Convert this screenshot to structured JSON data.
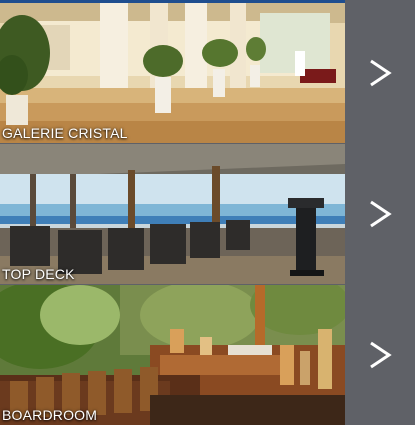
{
  "venues": [
    {
      "label": "GALERIE CRISTAL",
      "chevron_icon": "chevron-right-icon"
    },
    {
      "label": "TOP DECK",
      "chevron_icon": "chevron-right-icon"
    },
    {
      "label": "BOARDROOM",
      "chevron_icon": "chevron-right-icon"
    }
  ],
  "colors": {
    "panel": "#5f6167",
    "accent_bar": "#1f4e8f",
    "label_text": "#ffffff"
  }
}
